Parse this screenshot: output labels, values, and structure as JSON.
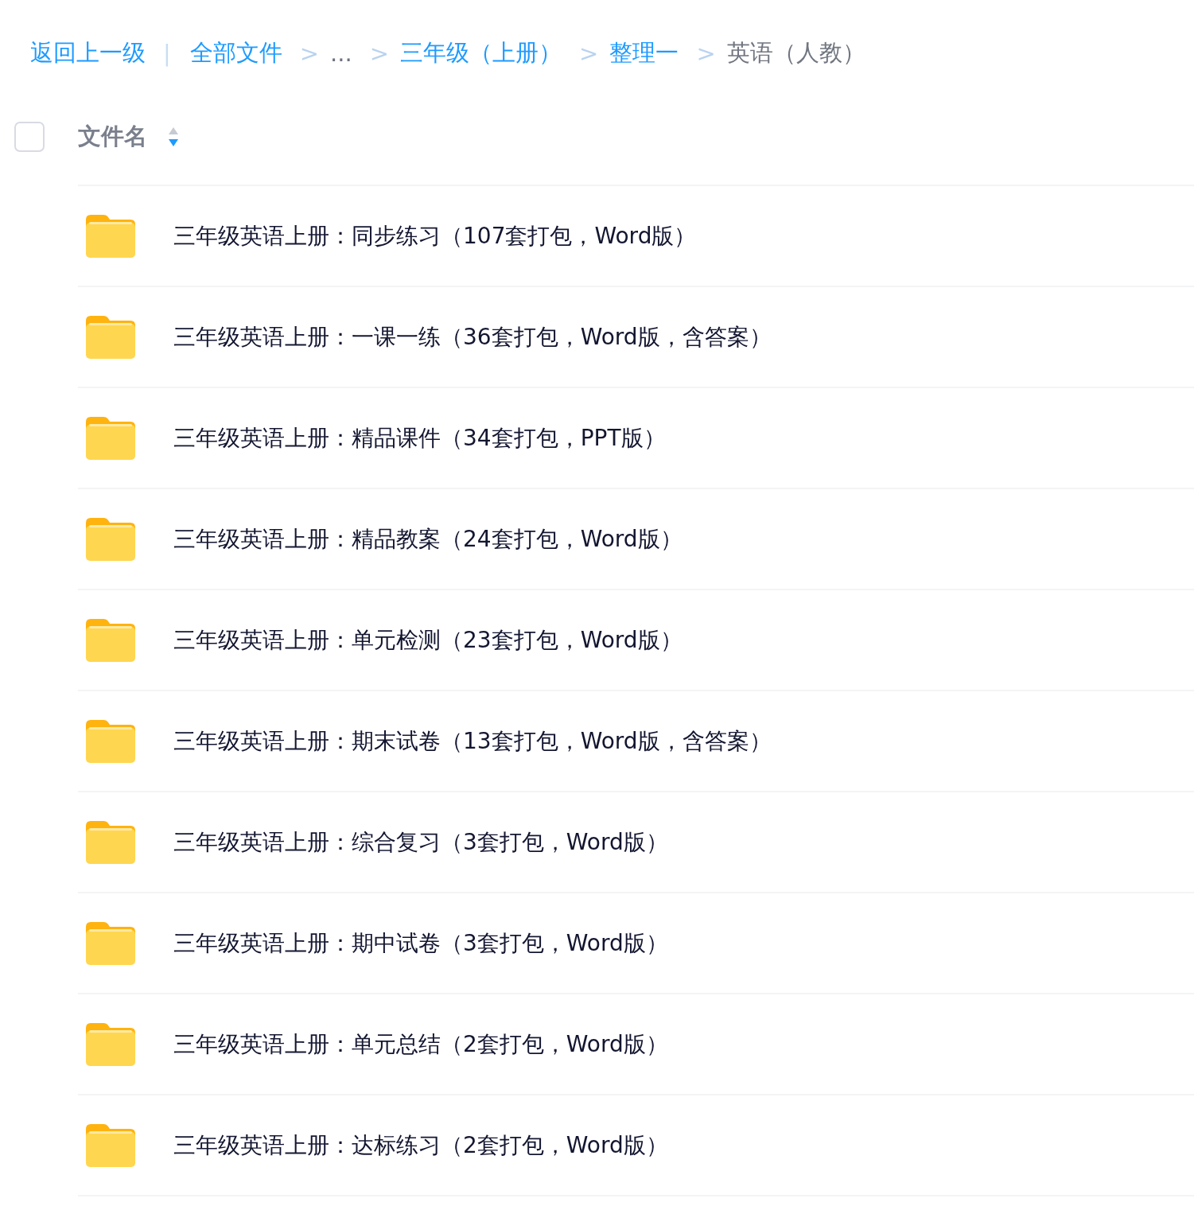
{
  "breadcrumb": {
    "back": "返回上一级",
    "divider": "|",
    "items": [
      {
        "label": "全部文件",
        "kind": "link"
      },
      {
        "label": "...",
        "kind": "more",
        "separator": ">"
      },
      {
        "label": "三年级（上册）",
        "kind": "link",
        "separator": ">"
      },
      {
        "label": "整理一",
        "kind": "link",
        "separator": ">"
      },
      {
        "label": "英语（人教）",
        "kind": "current",
        "separator": ">"
      }
    ]
  },
  "table": {
    "header": {
      "checked": false,
      "column": "文件名",
      "sort_descending": true
    },
    "rows": [
      {
        "name": "三年级英语上册：同步练习（107套打包，Word版）"
      },
      {
        "name": "三年级英语上册：一课一练（36套打包，Word版，含答案）"
      },
      {
        "name": "三年级英语上册：精品课件（34套打包，PPT版）"
      },
      {
        "name": "三年级英语上册：精品教案（24套打包，Word版）"
      },
      {
        "name": "三年级英语上册：单元检测（23套打包，Word版）"
      },
      {
        "name": "三年级英语上册：期末试卷（13套打包，Word版，含答案）"
      },
      {
        "name": "三年级英语上册：综合复习（3套打包，Word版）"
      },
      {
        "name": "三年级英语上册：期中试卷（3套打包，Word版）"
      },
      {
        "name": "三年级英语上册：单元总结（2套打包，Word版）"
      },
      {
        "name": "三年级英语上册：达标练习（2套打包，Word版）"
      }
    ]
  }
}
